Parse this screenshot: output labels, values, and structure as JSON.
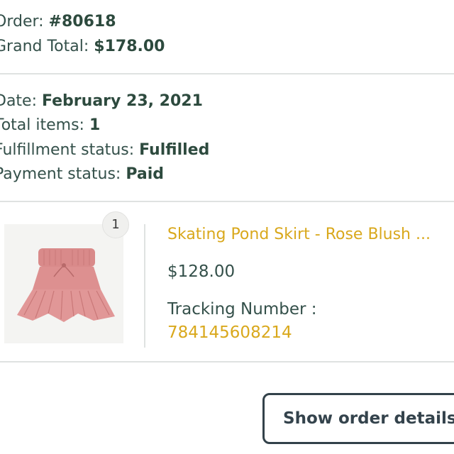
{
  "order": {
    "number_label": "Order: ",
    "number_value": "#80618",
    "total_label": "Grand Total: ",
    "total_value": "$178.00"
  },
  "summary": {
    "date_label": "Date: ",
    "date_value": "February 23, 2021",
    "items_label": "Total items: ",
    "items_value": "1",
    "fulfillment_label": "Fulfillment status: ",
    "fulfillment_value": "Fulfilled",
    "payment_label": "Payment status: ",
    "payment_value": "Paid"
  },
  "line_item": {
    "quantity": "1",
    "name": "Skating Pond Skirt - Rose Blush ...",
    "price": "$128.00",
    "tracking_label": "Tracking Number :",
    "tracking_number": "784145608214"
  },
  "actions": {
    "show_details_label": "Show order details"
  },
  "colors": {
    "text": "#2d4a3e",
    "accent": "#d9a81c",
    "divider": "#dfe2e1"
  }
}
